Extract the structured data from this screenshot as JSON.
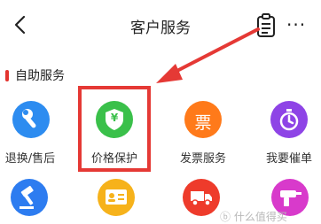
{
  "header": {
    "title": "客户服务",
    "more_label": "···"
  },
  "section": {
    "title": "自助服务"
  },
  "services_row1": [
    {
      "label": "退换/售后",
      "icon": "wrench-icon",
      "color": "#2d8cf0"
    },
    {
      "label": "价格保护",
      "icon": "price-protect-shield-icon",
      "color": "#3ac04a"
    },
    {
      "label": "发票服务",
      "icon": "invoice-icon",
      "color": "#ff7a1a"
    },
    {
      "label": "我要催单",
      "icon": "timer-icon",
      "color": "#8e44e6"
    }
  ],
  "services_row2": [
    {
      "icon": "gavel-icon",
      "color": "#2d7cf0"
    },
    {
      "icon": "id-card-icon",
      "color": "#f6b21b"
    },
    {
      "icon": "truck-icon",
      "color": "#ee3b2b"
    },
    {
      "icon": "drill-icon",
      "color": "#d83acb"
    }
  ],
  "icon_text": {
    "invoice": "票",
    "currency": "¥"
  },
  "watermark": "ⓑ 什么值得买"
}
